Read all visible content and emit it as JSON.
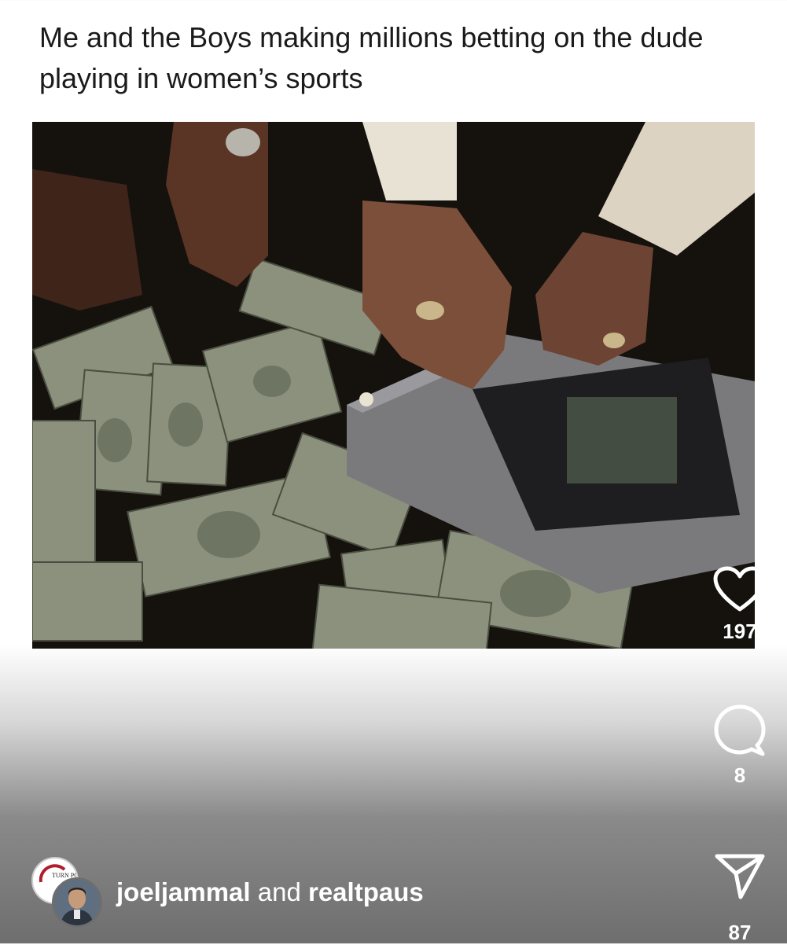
{
  "post": {
    "caption": "Me and the Boys making millions betting on the dude playing in women’s sports"
  },
  "actions": {
    "like": {
      "icon": "heart-icon",
      "count": "197"
    },
    "comment": {
      "icon": "comment-icon",
      "count": "8"
    },
    "share": {
      "icon": "send-icon",
      "count": "87"
    }
  },
  "authors": {
    "user1": "joeljammal",
    "connector": "and",
    "user2": "realtpaus",
    "avatar_back_text": "TURN POI"
  },
  "colors": {
    "icon": "#ffffff",
    "caption_text": "#1a1a1a"
  }
}
